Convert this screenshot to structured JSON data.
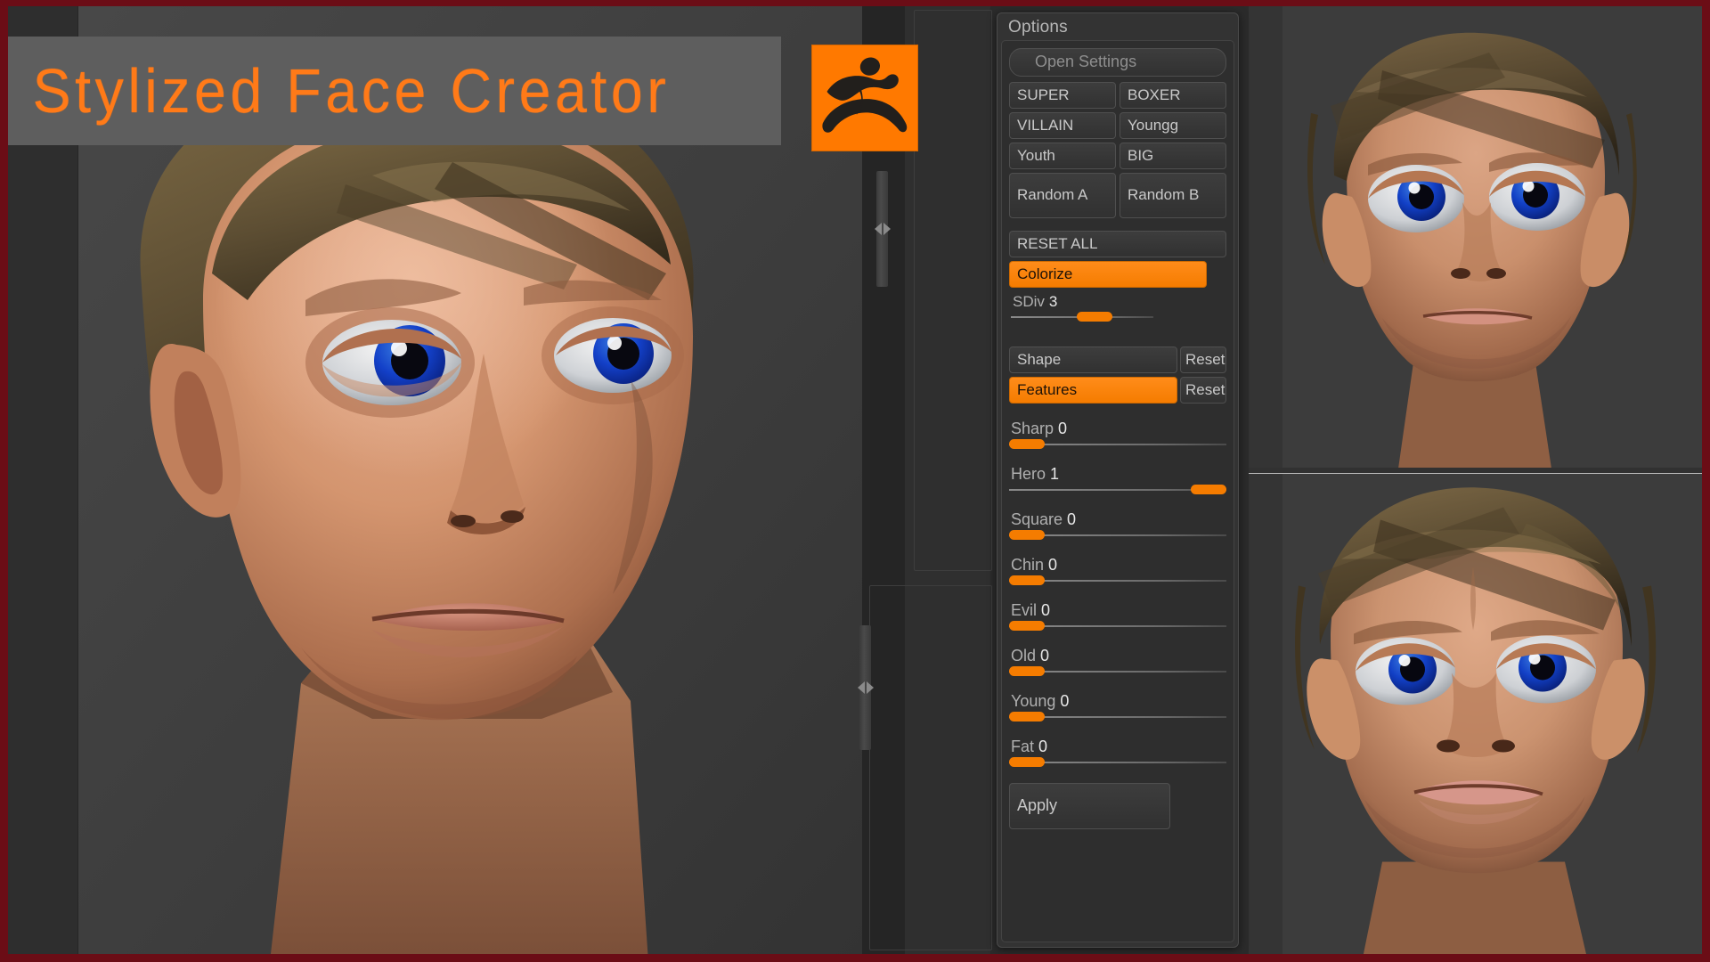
{
  "window": {
    "title": "Stylized Face Creator",
    "border_color": "#6b0d16",
    "accent_color": "#f57c00",
    "panel_bg": "#2e2e2e",
    "viewport_bg": "#3b3b3b"
  },
  "banner": {
    "title": "Stylized Face Creator",
    "background": "#5e5e5e",
    "text_color": "#ff7a18"
  },
  "logo": {
    "name": "zbrush-logo",
    "background": "#ff7900",
    "glyph_color": "#221f1c"
  },
  "options_panel": {
    "title": "Options",
    "open_settings_label": "Open Settings",
    "preset_buttons": [
      {
        "label": "SUPER",
        "active": false
      },
      {
        "label": "BOXER",
        "active": false
      },
      {
        "label": "VILLAIN",
        "active": false
      },
      {
        "label": "Youngg",
        "active": false
      },
      {
        "label": "Youth",
        "active": false
      },
      {
        "label": "BIG",
        "active": false
      }
    ],
    "random_buttons": [
      {
        "label": "Random A"
      },
      {
        "label": "Random B"
      }
    ],
    "reset_all_label": "RESET ALL",
    "colorize": {
      "label": "Colorize",
      "active": true
    },
    "sdiv": {
      "label": "SDiv",
      "value": "3",
      "percent": 62
    },
    "mode_rows": [
      {
        "label": "Shape",
        "active": false,
        "reset_label": "Reset"
      },
      {
        "label": "Features",
        "active": true,
        "reset_label": "Reset"
      }
    ],
    "feature_sliders": [
      {
        "label": "Sharp",
        "value": "0",
        "percent": 0
      },
      {
        "label": "Hero",
        "value": "1",
        "percent": 100
      },
      {
        "label": "Square",
        "value": "0",
        "percent": 0
      },
      {
        "label": "Chin",
        "value": "0",
        "percent": 0
      },
      {
        "label": "Evil",
        "value": "0",
        "percent": 0
      },
      {
        "label": "Old",
        "value": "0",
        "percent": 0
      },
      {
        "label": "Young",
        "value": "0",
        "percent": 0
      },
      {
        "label": "Fat",
        "value": "0",
        "percent": 0
      }
    ],
    "apply_label": "Apply"
  },
  "viewports": [
    {
      "name": "main-perspective-view",
      "subject": "stylized male head three-quarter view"
    },
    {
      "name": "front-view-top",
      "subject": "stylized male head front view"
    },
    {
      "name": "front-view-bottom",
      "subject": "stylized male head front view low angle"
    }
  ],
  "splitters": [
    {
      "name": "vertical-splitter-upper"
    },
    {
      "name": "vertical-splitter-lower"
    }
  ]
}
